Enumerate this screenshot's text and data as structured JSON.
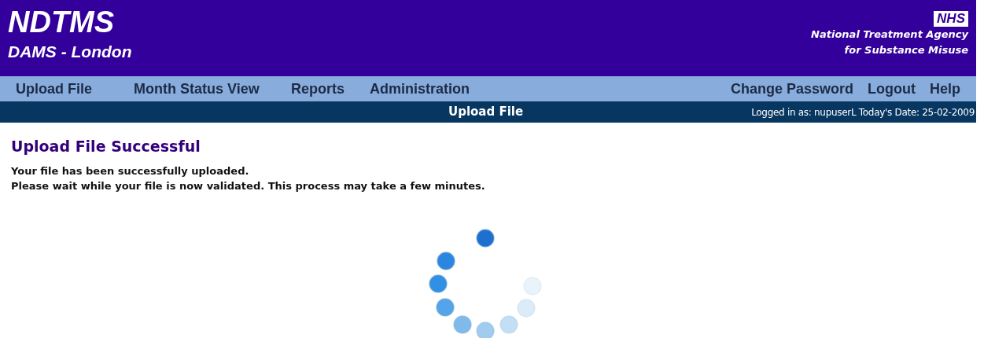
{
  "header": {
    "title": "NDTMS",
    "subtitle": "DAMS - London",
    "logo": "NHS",
    "agency_lines": [
      "National Treatment Agency",
      "for Substance Misuse"
    ]
  },
  "menu": {
    "left": [
      "Upload File",
      "Month Status View",
      "Reports",
      "Administration"
    ],
    "right": [
      "Change Password",
      "Logout",
      "Help"
    ]
  },
  "sub_bar": {
    "page": "Upload File",
    "login_info": "Logged in as: nupuserL Today's Date: 25-02-2009"
  },
  "content": {
    "heading": "Upload File Successful",
    "lines": [
      "Your file has been successfully uploaded.",
      "Please wait while your file is now validated. This process may take a few minutes."
    ]
  }
}
